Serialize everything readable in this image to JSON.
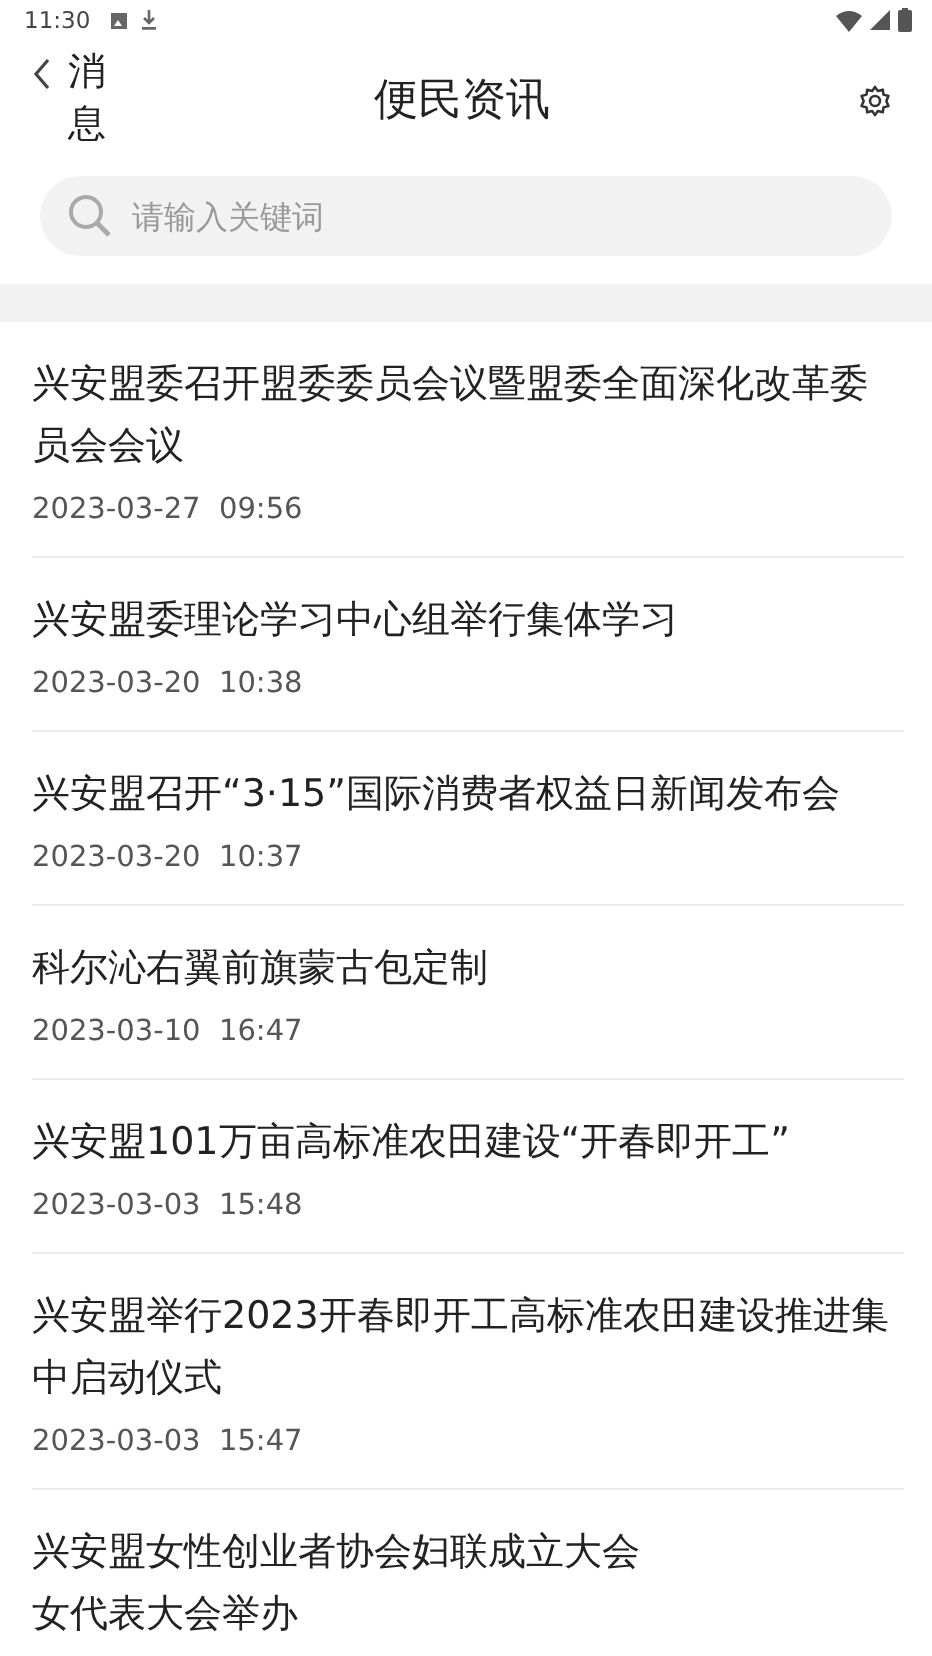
{
  "status_bar": {
    "time": "11:30"
  },
  "header": {
    "back_label": "消息",
    "title": "便民资讯"
  },
  "search": {
    "placeholder": "请输入关键词"
  },
  "news": [
    {
      "title": "兴安盟委召开盟委委员会议暨盟委全面深化改革委员会会议",
      "date": "2023-03-27  09:56"
    },
    {
      "title": "兴安盟委理论学习中心组举行集体学习",
      "date": "2023-03-20  10:38"
    },
    {
      "title": "兴安盟召开“3·15”国际消费者权益日新闻发布会",
      "date": "2023-03-20  10:37"
    },
    {
      "title": "科尔沁右翼前旗蒙古包定制",
      "date": "2023-03-10  16:47"
    },
    {
      "title": "兴安盟101万亩高标准农田建设“开春即开工”",
      "date": "2023-03-03  15:48"
    },
    {
      "title": "兴安盟举行2023开春即开工高标准农田建设推进集中启动仪式",
      "date": "2023-03-03  15:47"
    },
    {
      "title": "兴安盟女性创业者协会妇联成立大会"
    }
  ],
  "cut_line": "女代表大会举办"
}
